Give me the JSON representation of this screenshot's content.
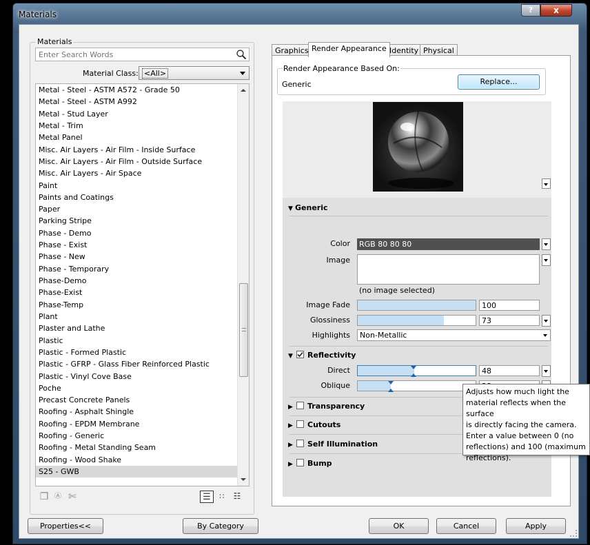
{
  "window": {
    "title": "Materials",
    "help": "?",
    "close": "x"
  },
  "materials_panel": {
    "group_label": "Materials",
    "search_placeholder": "Enter Search Words",
    "material_class_label": "Material Class:",
    "material_class_value": "<All>",
    "items": [
      "Metal - Steel - ASTM A572 - Grade 50",
      "Metal - Steel - ASTM A992",
      "Metal - Stud Layer",
      "Metal - Trim",
      "Metal Panel",
      "Misc. Air Layers - Air Film - Inside Surface",
      "Misc. Air Layers - Air Film - Outside Surface",
      "Misc. Air Layers - Air Space",
      "Paint",
      "Paints and Coatings",
      "Paper",
      "Parking Stripe",
      "Phase - Demo",
      "Phase - Exist",
      "Phase - New",
      "Phase - Temporary",
      "Phase-Demo",
      "Phase-Exist",
      "Phase-Temp",
      "Plant",
      "Plaster and Lathe",
      "Plastic",
      "Plastic - Formed Plastic",
      "Plastic - GFRP -  Glass Fiber Reinforced Plastic",
      "Plastic - Vinyl Cove Base",
      "Poche",
      "Precast Concrete Panels",
      "Roofing - Asphalt Shingle",
      "Roofing - EPDM Membrane",
      "Roofing - Generic",
      "Roofing - Metal Standing Seam",
      "Roofing - Wood Shake",
      "S25 - GWB"
    ],
    "selected_item": "S25 - GWB"
  },
  "tabs": [
    {
      "label": "Graphics"
    },
    {
      "label": "Render Appearance",
      "active": true
    },
    {
      "label": "Identity"
    },
    {
      "label": "Physical"
    }
  ],
  "render": {
    "based_on_label": "Render Appearance Based On:",
    "based_on_value": "Generic",
    "replace_label": "Replace...",
    "generic": {
      "header": "Generic",
      "color_label": "Color",
      "color_value": "RGB 80 80 80",
      "color_hex": "#505050",
      "image_label": "Image",
      "image_caption": "(no image selected)",
      "image_fade_label": "Image Fade",
      "image_fade_value": "100",
      "glossiness_label": "Glossiness",
      "glossiness_value": "73",
      "highlights_label": "Highlights",
      "highlights_value": "Non-Metallic"
    },
    "reflectivity": {
      "header": "Reflectivity",
      "checked": true,
      "direct_label": "Direct",
      "direct_value": "48",
      "oblique_label": "Oblique",
      "oblique_value": "28"
    },
    "collapsed_sections": [
      "Transparency",
      "Cutouts",
      "Self Illumination",
      "Bump"
    ]
  },
  "tooltip": {
    "lines": [
      "Adjusts how much light the",
      "material reflects when the surface",
      "is directly facing the camera.",
      "Enter a value between 0 (no",
      "reflections) and 100 (maximum",
      "reflections)."
    ]
  },
  "buttons": {
    "properties": "Properties<<",
    "by_category": "By Category",
    "ok": "OK",
    "cancel": "Cancel",
    "apply": "Apply"
  },
  "colors": {
    "accent_fill": "#c6dff3",
    "selection": "#d9d9d9"
  }
}
